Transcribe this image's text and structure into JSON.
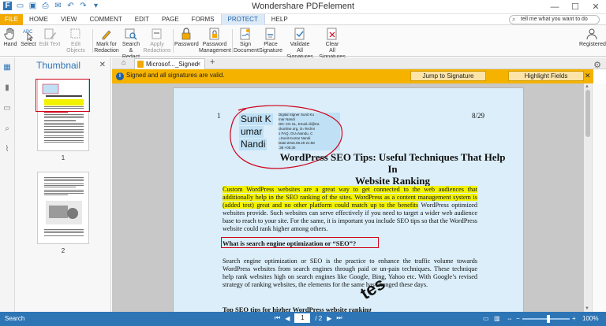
{
  "app": {
    "title": "Wondershare PDFelement"
  },
  "menu": {
    "file": "FILE",
    "tabs": [
      "HOME",
      "VIEW",
      "COMMENT",
      "EDIT",
      "PAGE",
      "FORMS",
      "PROTECT",
      "HELP"
    ],
    "active": "PROTECT",
    "tell_me_placeholder": "tell me what you want to do"
  },
  "ribbon": {
    "hand": "Hand",
    "select": "Select",
    "edit_text": "Edit Text",
    "edit_objects": "Edit Objects",
    "mark_redaction": [
      "Mark for",
      "Redaction"
    ],
    "search_redact": [
      "Search &",
      "Redact"
    ],
    "apply_redactions": [
      "Apply",
      "Redactions"
    ],
    "password": "Password",
    "password_mgmt": [
      "Password",
      "Management"
    ],
    "sign_document": [
      "Sign",
      "Document"
    ],
    "place_signature": [
      "Place",
      "Signature"
    ],
    "validate_all": [
      "Validate",
      "All Signatures"
    ],
    "clear_all": [
      "Clear",
      "All Signatures"
    ],
    "registered": "Registered"
  },
  "thumbnails": {
    "title": "Thumbnail",
    "pages": [
      "1",
      "2"
    ]
  },
  "doc_tab": {
    "name": "Microsof..._Signed"
  },
  "notification": {
    "text": "Signed and all signatures are valid.",
    "jump": "Jump to Signature",
    "highlight": "Highlight Fields"
  },
  "page": {
    "left_num": "1",
    "right_num": "8/29",
    "signature_name": [
      "Sunit K",
      "umar",
      "Nandi"
    ],
    "signature_detail": [
      "Digital Signer Sunit Ku",
      "mar Nandi",
      "DN: CN SL, Email=ili@tra",
      "ckonline.org, O=Techni",
      "x FAQ, OU=Nandu, C",
      "=Sunit Kumar Nandi",
      "Date:2016.08.29 21:58",
      ":38 +05:30"
    ],
    "title_line1": "WordPress SEO Tips: Useful Techniques That Help In",
    "title_line2": "Website Ranking",
    "para1_hl": "Custom WordPress websites are a great way to get connected to the web audiences that additionally help in the SEO ranking of the sites. WordPress as a content management system is (added test) great and no other platform could match up to the benefits",
    "para1_rest": "WordPress optimized websites provide. Such websites can serve effectively if you need to target a wider web audience base to reach to your site. For the same, it is important you include SEO tips so that the WordPress website could rank higher among others.",
    "heading2": "What is search engine optimization or “SEO”?",
    "para2": "Search engine optimization or SEO is the practice to enhance the traffic volume towards WordPress websites from search engines through paid or un-pain techniques. These technique help rank websites high on search engines like Google, Bing, Yahoo etc. With Google’s revised strategy of ranking websites, the elements for the same has changed these days.",
    "heading3": "Top SEO tips for higher WordPress website ranking",
    "stamp": "tes"
  },
  "status": {
    "search": "Search",
    "current_page": "1",
    "total_pages": "/ 2",
    "zoom": "100%"
  },
  "colors": {
    "accent": "#2e75b6",
    "file_tab": "#f2a900",
    "notification": "#f5b300",
    "highlight": "#f2f200",
    "markup_red": "#d0021b"
  }
}
